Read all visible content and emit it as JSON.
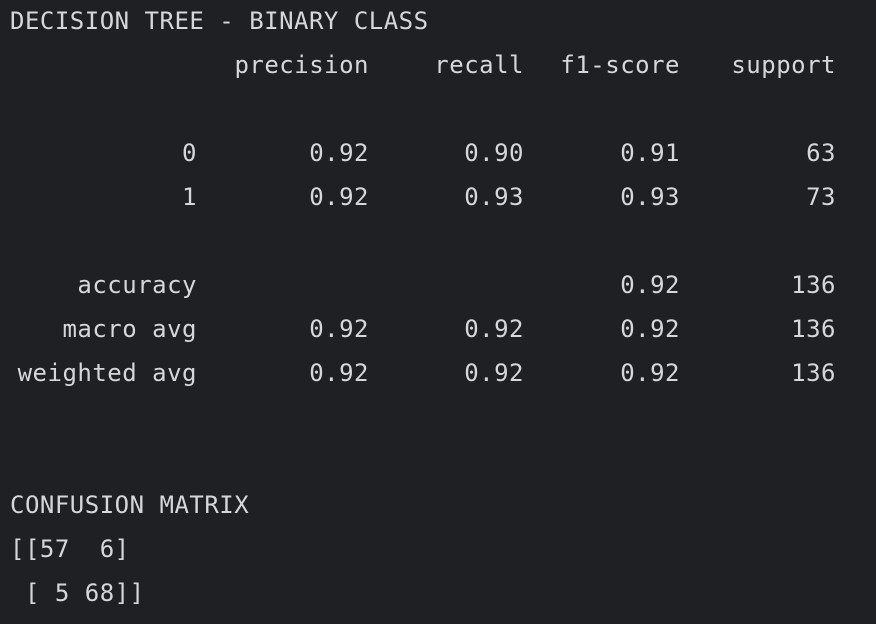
{
  "report": {
    "title": "DECISION TREE - BINARY CLASS",
    "headers": [
      "precision",
      "recall",
      "f1-score",
      "support"
    ],
    "rows": [
      {
        "label": "0",
        "precision": "0.92",
        "recall": "0.90",
        "f1": "0.91",
        "support": "63"
      },
      {
        "label": "1",
        "precision": "0.92",
        "recall": "0.93",
        "f1": "0.93",
        "support": "73"
      },
      {
        "label": "accuracy",
        "precision": "",
        "recall": "",
        "f1": "0.92",
        "support": "136"
      },
      {
        "label": "macro avg",
        "precision": "0.92",
        "recall": "0.92",
        "f1": "0.92",
        "support": "136"
      },
      {
        "label": "weighted avg",
        "precision": "0.92",
        "recall": "0.92",
        "f1": "0.92",
        "support": "136"
      }
    ]
  },
  "confusion_matrix": {
    "title": "CONFUSION MATRIX",
    "line1": "[[57  6]",
    "line2": " [ 5 68]]"
  }
}
